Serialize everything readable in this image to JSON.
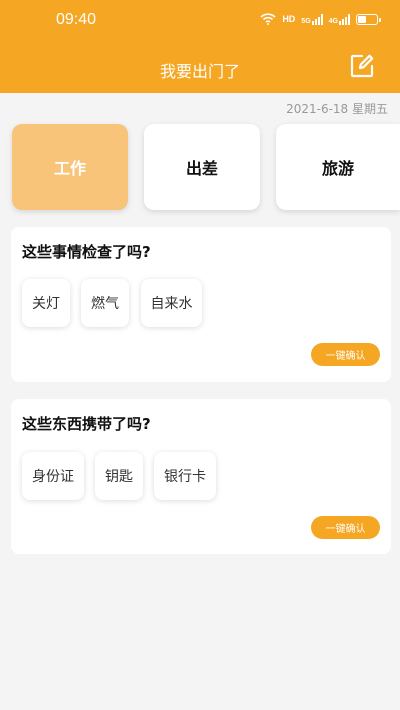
{
  "status": {
    "time": "09:40",
    "network_label": "HD",
    "signal_5g": "5G",
    "signal_4g": "4G"
  },
  "header": {
    "title": "我要出门了",
    "edit_icon": "edit-icon"
  },
  "date": "2021-6-18 星期五",
  "categories": [
    {
      "label": "工作",
      "active": true
    },
    {
      "label": "出差",
      "active": false
    },
    {
      "label": "旅游",
      "active": false
    }
  ],
  "check_card": {
    "title": "这些事情检查了吗?",
    "items": [
      "关灯",
      "燃气",
      "自来水"
    ],
    "confirm_label": "一键确认"
  },
  "carry_card": {
    "title": "这些东西携带了吗?",
    "items": [
      "身份证",
      "钥匙",
      "银行卡"
    ],
    "confirm_label": "一键确认"
  },
  "colors": {
    "accent": "#f5a623",
    "active_category": "#f8c47a",
    "background": "#f4f4f4"
  }
}
